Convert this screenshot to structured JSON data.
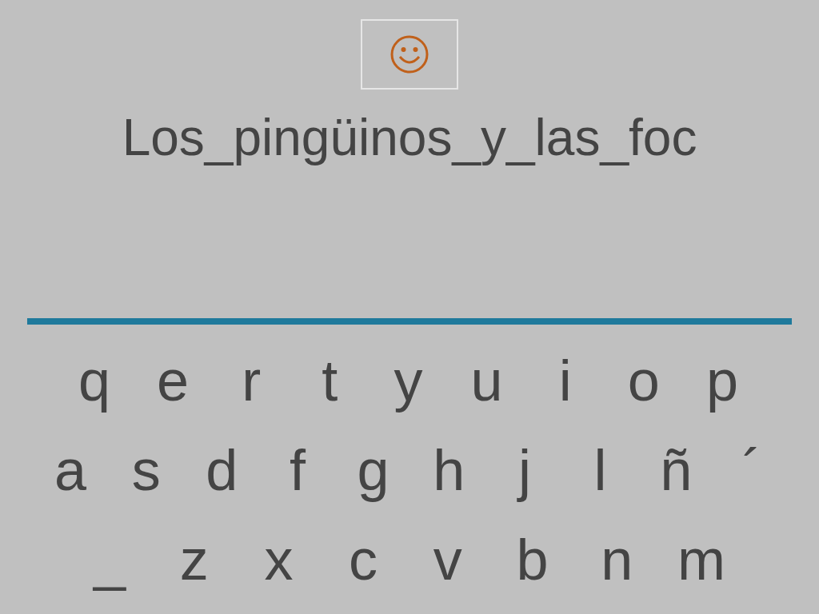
{
  "phrase": "Los_pingüinos_y_las_foc",
  "keyboard": {
    "rows": [
      [
        "q",
        "e",
        "r",
        "t",
        "y",
        "u",
        "i",
        "o",
        "p"
      ],
      [
        "a",
        "s",
        "d",
        "f",
        "g",
        "h",
        "j",
        "l",
        "ñ",
        "´"
      ],
      [
        "_",
        "z",
        "x",
        "c",
        "v",
        "b",
        "n",
        "m"
      ]
    ]
  }
}
